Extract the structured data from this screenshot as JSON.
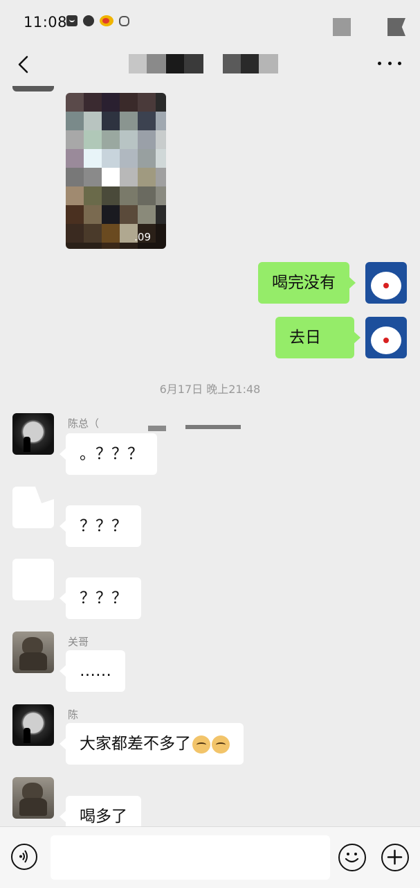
{
  "status_bar": {
    "time": "11:08",
    "icons": [
      "mail-icon",
      "chat-icon",
      "weibo-icon",
      "hand-icon"
    ]
  },
  "nav": {
    "back_icon": "chevron-left-icon",
    "more_icon": "more-dots-icon"
  },
  "messages": [
    {
      "side": "left",
      "kind": "video",
      "duration": ".09"
    },
    {
      "side": "right",
      "kind": "text",
      "text": "喝完没有"
    },
    {
      "side": "right",
      "kind": "text",
      "text": "去日"
    },
    {
      "kind": "timestamp",
      "text": "6月17日 晚上21:48"
    },
    {
      "side": "left",
      "kind": "text",
      "sender": "陈总（",
      "text": "。？？？"
    },
    {
      "side": "left",
      "kind": "text",
      "sender": "",
      "text": "？？？"
    },
    {
      "side": "left",
      "kind": "text",
      "sender": "",
      "text": "？？？"
    },
    {
      "side": "left",
      "kind": "text",
      "sender": "关哥",
      "text": "……"
    },
    {
      "side": "left",
      "kind": "text",
      "sender": "陈",
      "text": "大家都差不多了",
      "emoji": [
        "doge",
        "doge"
      ]
    },
    {
      "side": "left",
      "kind": "text",
      "sender": "",
      "text": "喝多了"
    }
  ],
  "input_bar": {
    "voice_icon": "voice-icon",
    "emoji_icon": "emoji-icon",
    "plus_icon": "plus-icon",
    "placeholder": ""
  },
  "colors": {
    "background": "#ededed",
    "sent_bubble": "#95ec69",
    "received_bubble": "#ffffff"
  }
}
